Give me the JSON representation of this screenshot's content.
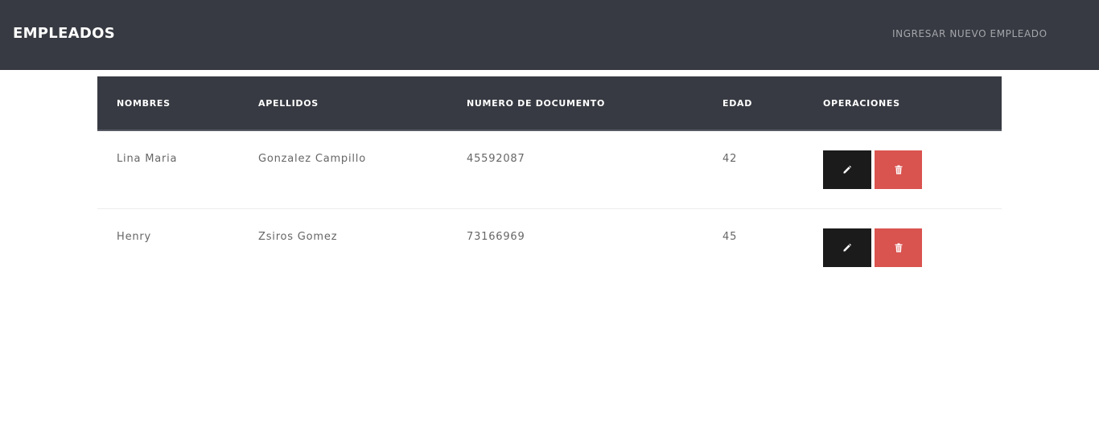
{
  "header": {
    "brand": "EMPLEADOS",
    "new_employee_link": "INGRESAR NUEVO EMPLEADO"
  },
  "table": {
    "columns": [
      "NOMBRES",
      "APELLIDOS",
      "NUMERO DE DOCUMENTO",
      "EDAD",
      "OPERACIONES"
    ],
    "rows": [
      {
        "nombres": "Lina Maria",
        "apellidos": "Gonzalez Campillo",
        "documento": "45592087",
        "edad": "42"
      },
      {
        "nombres": "Henry",
        "apellidos": "Zsiros Gomez",
        "documento": "73166969",
        "edad": "45"
      }
    ]
  },
  "icons": {
    "edit": "pencil-icon",
    "delete": "trash-icon"
  },
  "colors": {
    "navbar": "#373a42",
    "edit_button": "#1b1b1b",
    "delete_button": "#d9534f"
  }
}
